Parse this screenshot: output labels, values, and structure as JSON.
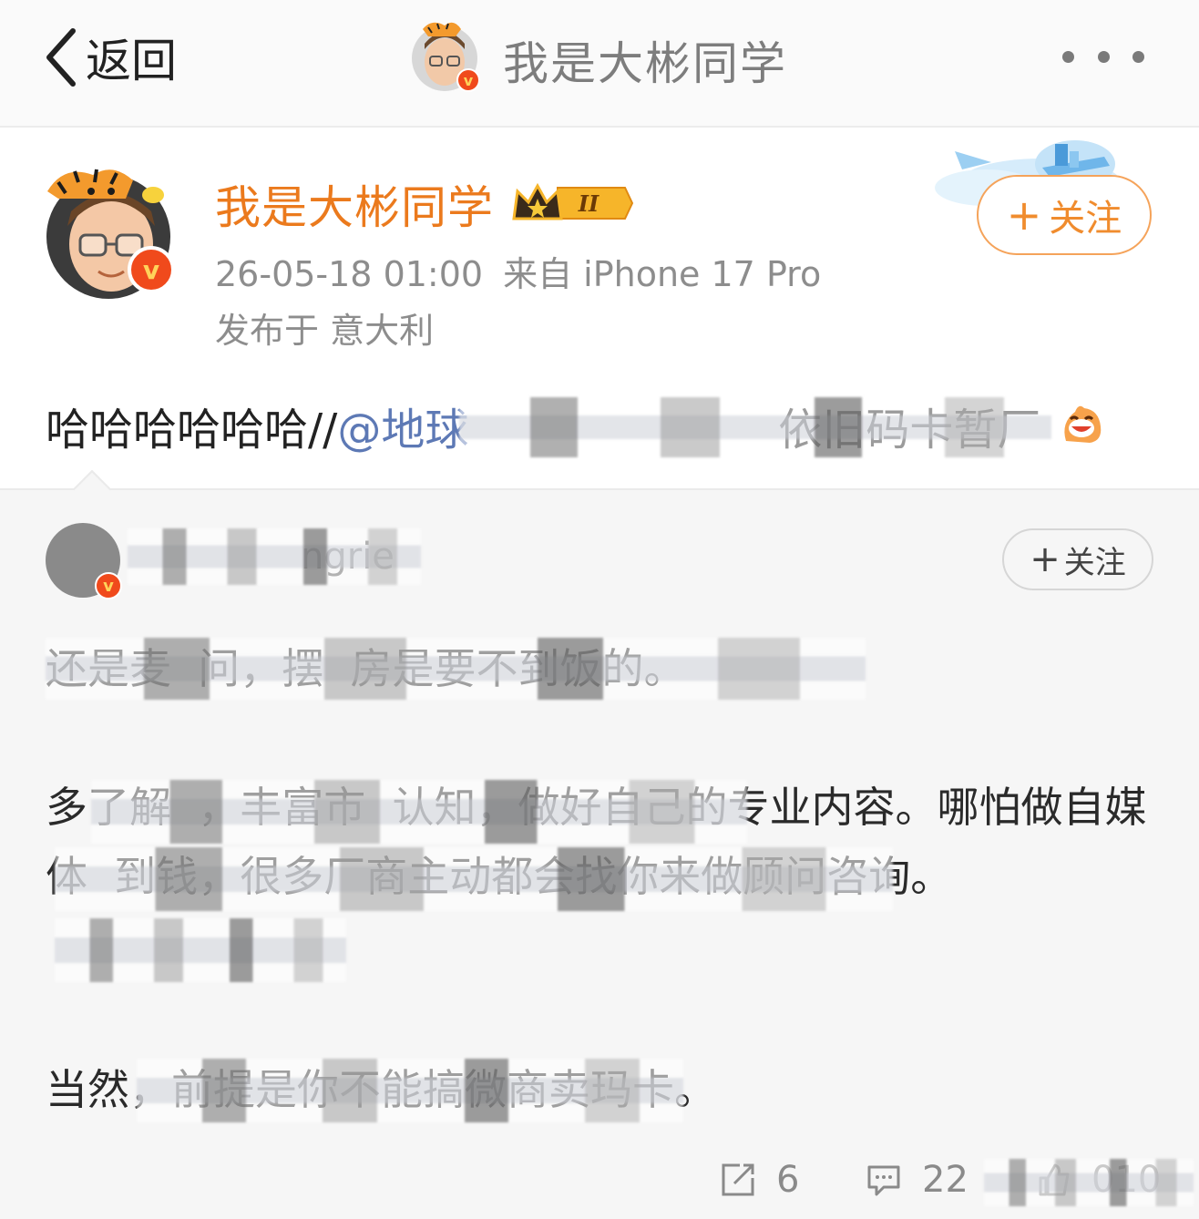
{
  "nav": {
    "back_label": "返回",
    "title": "我是大彬同学"
  },
  "post": {
    "author_name": "我是大彬同学",
    "vip_level": "II",
    "timestamp": "26-05-18 01:00",
    "source": "来自 iPhone 17 Pro",
    "location": "发布于 意大利",
    "follow_label": "关注",
    "text_prefix": "哈哈哈哈哈哈//",
    "mention": "@地球",
    "text_suffix": "依旧码卡暂厂"
  },
  "repost": {
    "author_name": "ngrie",
    "follow_label": "关注",
    "paragraph_1": "还是麦  问，摆  房是要不到饭的。",
    "paragraph_2": "多了解  ，丰富市  认知，做好自己的专业内容。哪怕做自媒体  到钱，很多厂商主动都会找你来做顾问咨询。",
    "paragraph_3": "当然，前提是你不能搞微商卖玛卡。"
  },
  "actions": {
    "repost_count": "6",
    "comment_count": "22",
    "like_count": "010"
  },
  "colors": {
    "accent_orange": "#eb7a1d",
    "mention_blue": "#5d79b5",
    "meta_gray": "#8d8d8d"
  }
}
